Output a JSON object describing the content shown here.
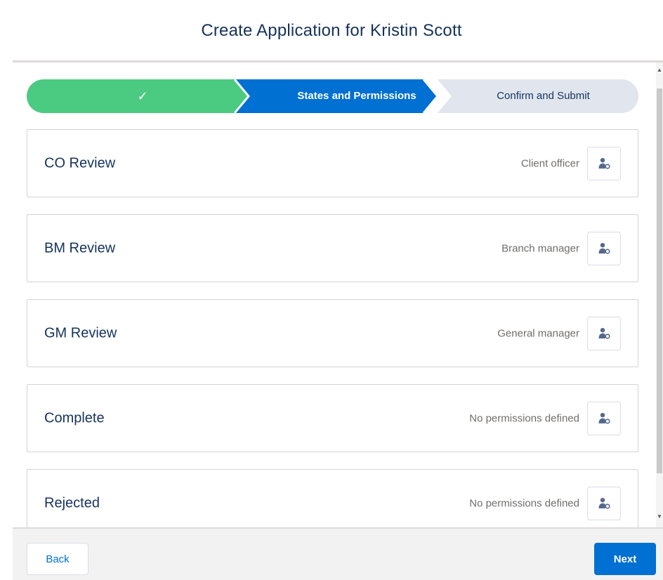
{
  "modal": {
    "title": "Create Application for Kristin Scott"
  },
  "path": {
    "steps": [
      {
        "label": "✓",
        "status": "complete",
        "icon": "check-icon"
      },
      {
        "label": "States and Permissions",
        "status": "current"
      },
      {
        "label": "Confirm and Submit",
        "status": "upcoming"
      }
    ]
  },
  "states": [
    {
      "name": "CO Review",
      "permission": "Client officer",
      "icon": "user-settings-icon"
    },
    {
      "name": "BM Review",
      "permission": "Branch manager",
      "icon": "user-settings-icon"
    },
    {
      "name": "GM Review",
      "permission": "General manager",
      "icon": "user-settings-icon"
    },
    {
      "name": "Complete",
      "permission": "No permissions defined",
      "icon": "user-settings-icon"
    },
    {
      "name": "Rejected",
      "permission": "No permissions defined",
      "icon": "user-settings-icon"
    }
  ],
  "footer": {
    "back_label": "Back",
    "next_label": "Next"
  },
  "colors": {
    "complete": "#4bca81",
    "current": "#0070d2",
    "upcoming": "#e0e5ee",
    "brand": "#0070d2",
    "text": "#16325c"
  }
}
